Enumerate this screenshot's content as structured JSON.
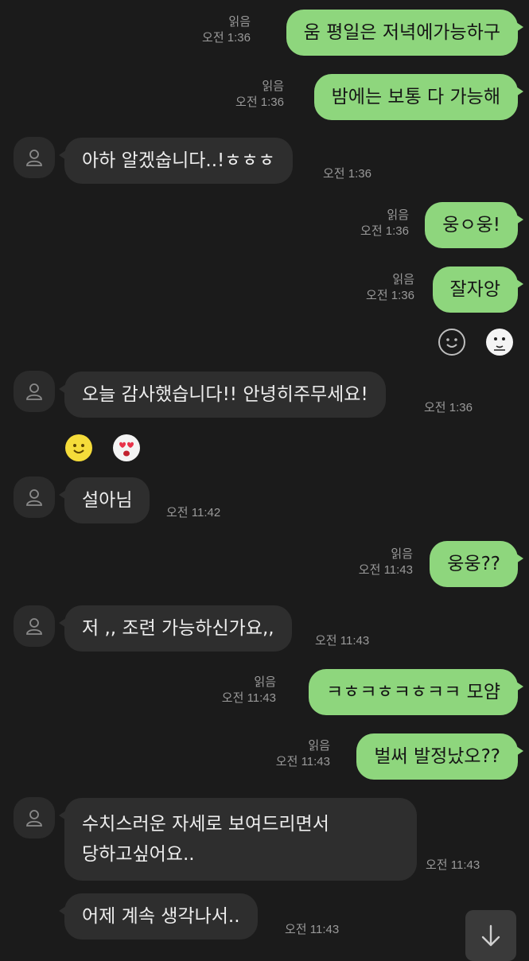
{
  "messages": [
    {
      "from": "me",
      "text": "움 평일은 저녁에가능하구",
      "read": "읽음",
      "time": "오전 1:36"
    },
    {
      "from": "me",
      "text": "밤에는 보통 다 가능해",
      "read": "읽음",
      "time": "오전 1:36"
    },
    {
      "from": "them",
      "text": "아하 알겠숩니다..!ㅎㅎㅎ",
      "time": "오전 1:36"
    },
    {
      "from": "me",
      "text": "웅ㅇ웅!",
      "read": "읽음",
      "time": "오전 1:36"
    },
    {
      "from": "me",
      "text": "잘자앙",
      "read": "읽음",
      "time": "오전 1:36"
    },
    {
      "from": "them",
      "text": "오늘 감사했습니다!! 안녕히주무세요!",
      "time": "오전 1:36"
    },
    {
      "from": "them",
      "text": "설아님",
      "time": "오전 11:42"
    },
    {
      "from": "me",
      "text": "웅웅??",
      "read": "읽음",
      "time": "오전 11:43"
    },
    {
      "from": "them",
      "text": "저 ,, 조련 가능하신가요,,",
      "time": "오전 11:43"
    },
    {
      "from": "me",
      "text": "ㅋㅎㅋㅎㅋㅎㅋㅋ 모얌",
      "read": "읽음",
      "time": "오전 11:43"
    },
    {
      "from": "me",
      "text": "벌써 발정났오??",
      "read": "읽음",
      "time": "오전 11:43"
    },
    {
      "from": "them",
      "text_line1": "수치스러운 자세로 보여드리면서",
      "text_line2": "당하고싶어요..",
      "time": "오전 11:43"
    },
    {
      "from": "them",
      "text": "어제 계속 생각나서..",
      "time": "오전 11:43"
    }
  ],
  "icons": {
    "avatar": "person-icon",
    "reaction1": "smiley-outline-icon",
    "reaction2": "cartoon-face-icon",
    "reaction3": "smiley-yellow-icon",
    "reaction4": "heart-eyes-icon",
    "scroll": "arrow-down-icon"
  },
  "colors": {
    "background": "#1b1b1b",
    "outgoing_bubble": "#8ed67d",
    "incoming_bubble": "#2e2e2e",
    "meta_text": "#9a9a9a"
  }
}
